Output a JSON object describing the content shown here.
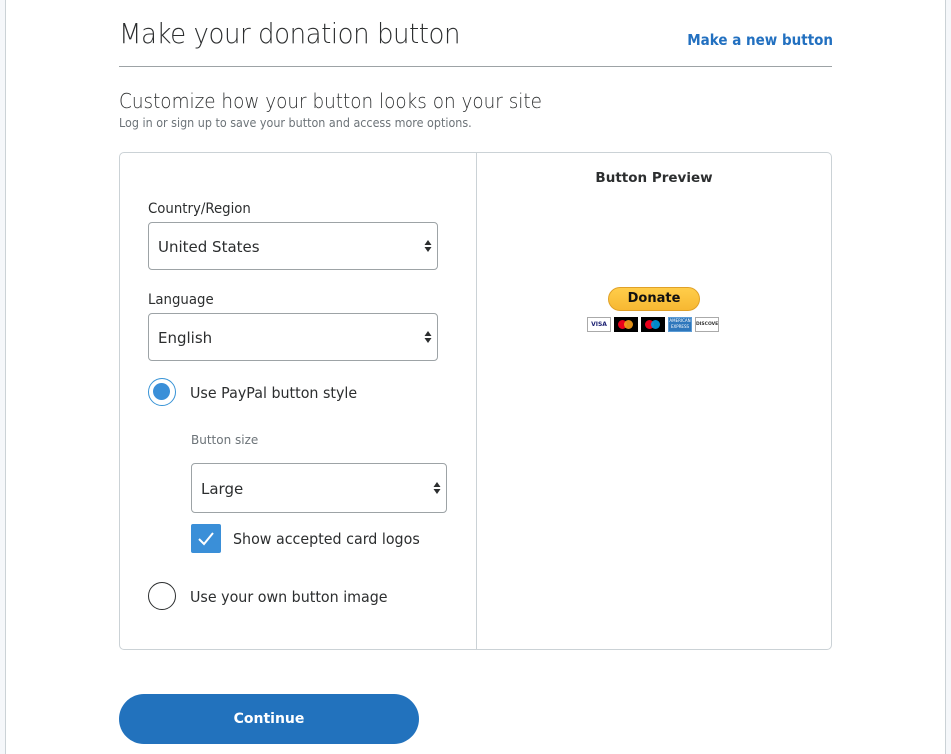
{
  "header": {
    "title": "Make your donation button",
    "new_button_link": "Make a new button"
  },
  "section": {
    "title": "Customize how your button looks on your site",
    "hint": "Log in or sign up to save your button and access more options."
  },
  "form": {
    "country": {
      "label": "Country/Region",
      "value": "United States"
    },
    "language": {
      "label": "Language",
      "value": "English"
    },
    "style_options": [
      {
        "label": "Use PayPal button style",
        "selected": true
      },
      {
        "label": "Use your own button image",
        "selected": false
      }
    ],
    "button_size": {
      "label": "Button size",
      "value": "Large"
    },
    "show_card_logos": {
      "label": "Show accepted card logos",
      "checked": true
    }
  },
  "preview": {
    "title": "Button Preview",
    "donate_label": "Donate",
    "cards": [
      {
        "name": "visa",
        "text": "VISA"
      },
      {
        "name": "mastercard",
        "text": ""
      },
      {
        "name": "maestro",
        "text": ""
      },
      {
        "name": "american-express",
        "text": "AMERICAN EXPRESS"
      },
      {
        "name": "discover",
        "text": "DISCOVER"
      }
    ]
  },
  "actions": {
    "continue_label": "Continue"
  },
  "colors": {
    "accent": "#2272bd",
    "radio_checkbox": "#3a8fd8",
    "donate_yellow": "#ffc439"
  }
}
